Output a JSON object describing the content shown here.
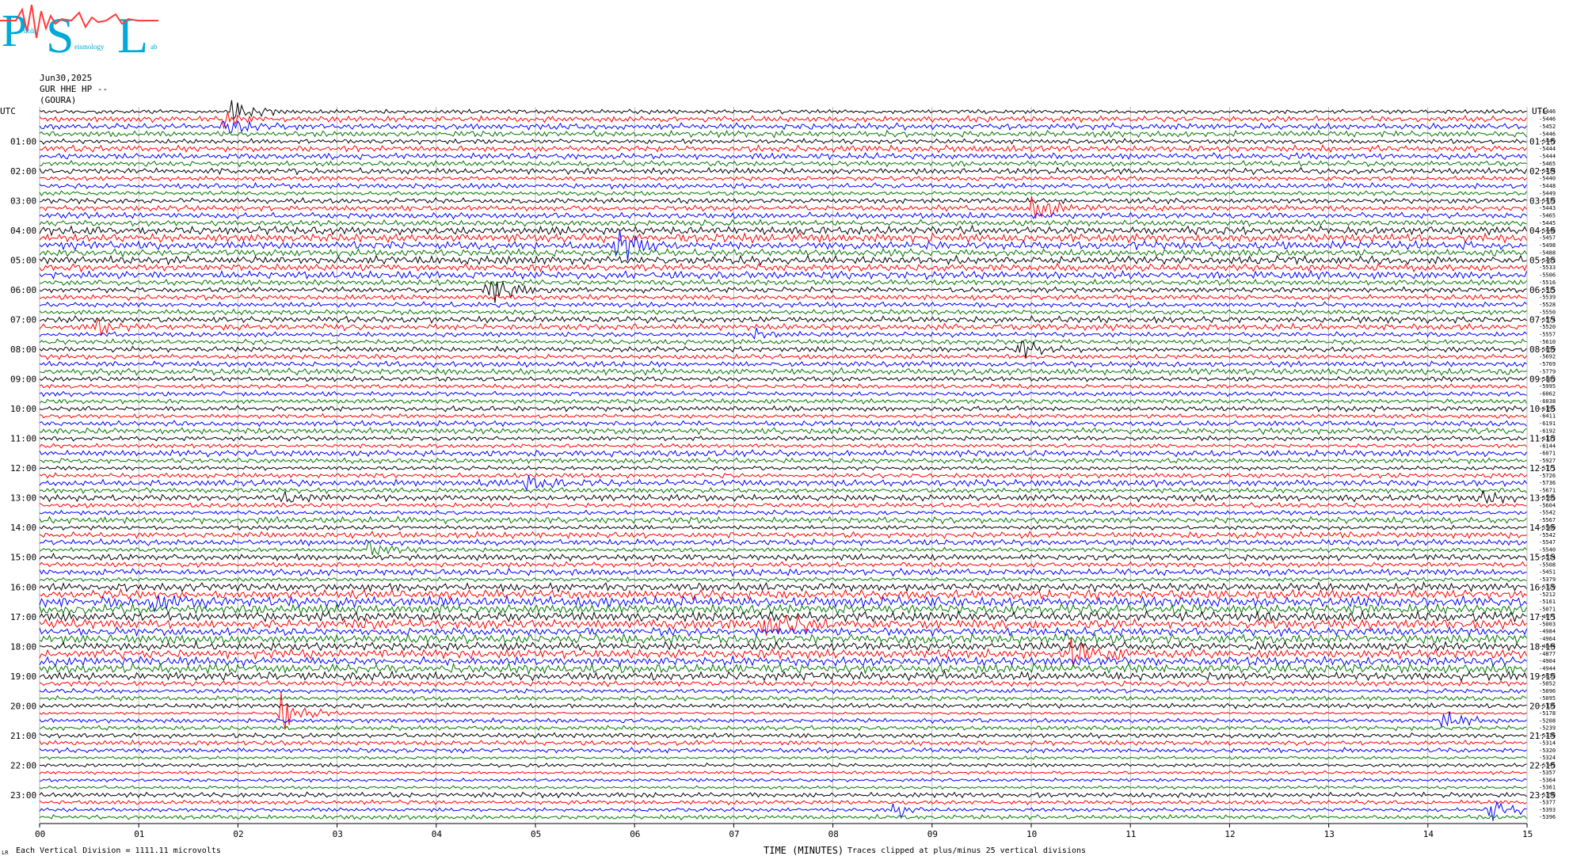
{
  "logo": {
    "letters": [
      "P",
      "S",
      "L"
    ],
    "subtext_1": "ublic",
    "subtext_2": "eismology",
    "subtext_3": "ab",
    "colors": [
      "#00a9d8",
      "#ff3b3b"
    ]
  },
  "header": {
    "date": "Jun30,2025",
    "channel": "GUR HHE HP --",
    "location": "(GOURA)"
  },
  "footer": {
    "corner_label": "LR",
    "scale_note": "Each Vertical Division = 1111.11 microvolts",
    "xlabel": "TIME (MINUTES)",
    "clip_note": "Traces clipped at plus/minus 25 vertical divisions"
  },
  "colors": {
    "black": "#000000",
    "red": "#ff0000",
    "blue": "#0000ff",
    "green": "#007700",
    "grid": "#888888"
  },
  "chart_data": {
    "type": "line",
    "title": "Jun30,2025",
    "xlabel": "TIME (MINUTES)",
    "xlim": [
      0,
      15
    ],
    "x_ticks": [
      "00",
      "01",
      "02",
      "03",
      "04",
      "05",
      "06",
      "07",
      "08",
      "09",
      "10",
      "11",
      "12",
      "13",
      "14",
      "15"
    ],
    "left_axis_label": "UTC",
    "right_axis_label": "UTC",
    "left_ticks": [
      "01:00",
      "02:00",
      "03:00",
      "04:00",
      "05:00",
      "06:00",
      "07:00",
      "08:00",
      "09:00",
      "10:00",
      "11:00",
      "12:00",
      "13:00",
      "14:00",
      "15:00",
      "16:00",
      "17:00",
      "18:00",
      "19:00",
      "20:00",
      "21:00",
      "22:00",
      "23:00"
    ],
    "right_ticks": [
      "01:15",
      "02:15",
      "03:15",
      "04:15",
      "05:15",
      "06:15",
      "07:15",
      "08:15",
      "09:15",
      "10:15",
      "11:15",
      "12:15",
      "13:15",
      "14:15",
      "15:15",
      "16:15",
      "17:15",
      "18:15",
      "19:15",
      "20:15",
      "21:15",
      "22:15",
      "23:15"
    ],
    "trace_color_cycle": [
      "black",
      "red",
      "blue",
      "green"
    ],
    "trace_minutes": 15,
    "trace_count": 96,
    "trace_offsets": [
      "-5446",
      "-5446",
      "-5452",
      "-5446",
      "-5449",
      "-5444",
      "-5444",
      "-5465",
      "-5434",
      "-5440",
      "-5448",
      "-5449",
      "-5433",
      "-5443",
      "-5465",
      "-5445",
      "-5448",
      "-5457",
      "-5498",
      "-5488",
      "-5493",
      "-5533",
      "-5506",
      "-5516",
      "-5515",
      "-5539",
      "-5528",
      "-5550",
      "-5574",
      "-5520",
      "-5557",
      "-5610",
      "-5659",
      "-5692",
      "-5769",
      "-5779",
      "-5883",
      "-5995",
      "-6062",
      "-6038",
      "-6155",
      "-6411",
      "-6191",
      "-6192",
      "-6137",
      "-6144",
      "-6071",
      "-5927",
      "-5771",
      "-5726",
      "-5736",
      "-5671",
      "-5595",
      "-5604",
      "-5542",
      "-5567",
      "-5560",
      "-5542",
      "-5547",
      "-5540",
      "-5514",
      "-5508",
      "-5451",
      "-5379",
      "-5320",
      "-5212",
      "-5161",
      "-5071",
      "-4971",
      "-5003",
      "-4984",
      "-4964",
      "-4844",
      "-4877",
      "-4904",
      "-4944",
      "-5033",
      "-5052",
      "-5096",
      "-5095",
      "-5135",
      "-5178",
      "-5208",
      "-5239",
      "-5316",
      "-5314",
      "-5320",
      "-5324",
      "-5345",
      "-5357",
      "-5364",
      "-5361",
      "-5358",
      "-5377",
      "-5393",
      "-5396"
    ],
    "events": [
      {
        "trace": 0,
        "minute": 1.9,
        "amplitude": 22
      },
      {
        "trace": 1,
        "minute": 1.85,
        "amplitude": 10
      },
      {
        "trace": 2,
        "minute": 1.85,
        "amplitude": 12
      },
      {
        "trace": 13,
        "minute": 10.0,
        "amplitude": 18
      },
      {
        "trace": 18,
        "minute": 5.8,
        "amplitude": 22
      },
      {
        "trace": 24,
        "minute": 4.5,
        "amplitude": 28
      },
      {
        "trace": 29,
        "minute": 0.55,
        "amplitude": 10
      },
      {
        "trace": 30,
        "minute": 7.15,
        "amplitude": 10
      },
      {
        "trace": 32,
        "minute": 9.85,
        "amplitude": 14
      },
      {
        "trace": 50,
        "minute": 4.9,
        "amplitude": 12
      },
      {
        "trace": 52,
        "minute": 2.45,
        "amplitude": 9
      },
      {
        "trace": 52,
        "minute": 14.5,
        "amplitude": 10
      },
      {
        "trace": 59,
        "minute": 3.3,
        "amplitude": 14
      },
      {
        "trace": 66,
        "minute": 1.1,
        "amplitude": 14
      },
      {
        "trace": 69,
        "minute": 7.3,
        "amplitude": 30
      },
      {
        "trace": 73,
        "minute": 10.4,
        "amplitude": 30
      },
      {
        "trace": 81,
        "minute": 2.4,
        "amplitude": 30
      },
      {
        "trace": 82,
        "minute": 14.15,
        "amplitude": 12
      },
      {
        "trace": 94,
        "minute": 8.6,
        "amplitude": 12
      },
      {
        "trace": 94,
        "minute": 14.6,
        "amplitude": 20
      }
    ]
  }
}
